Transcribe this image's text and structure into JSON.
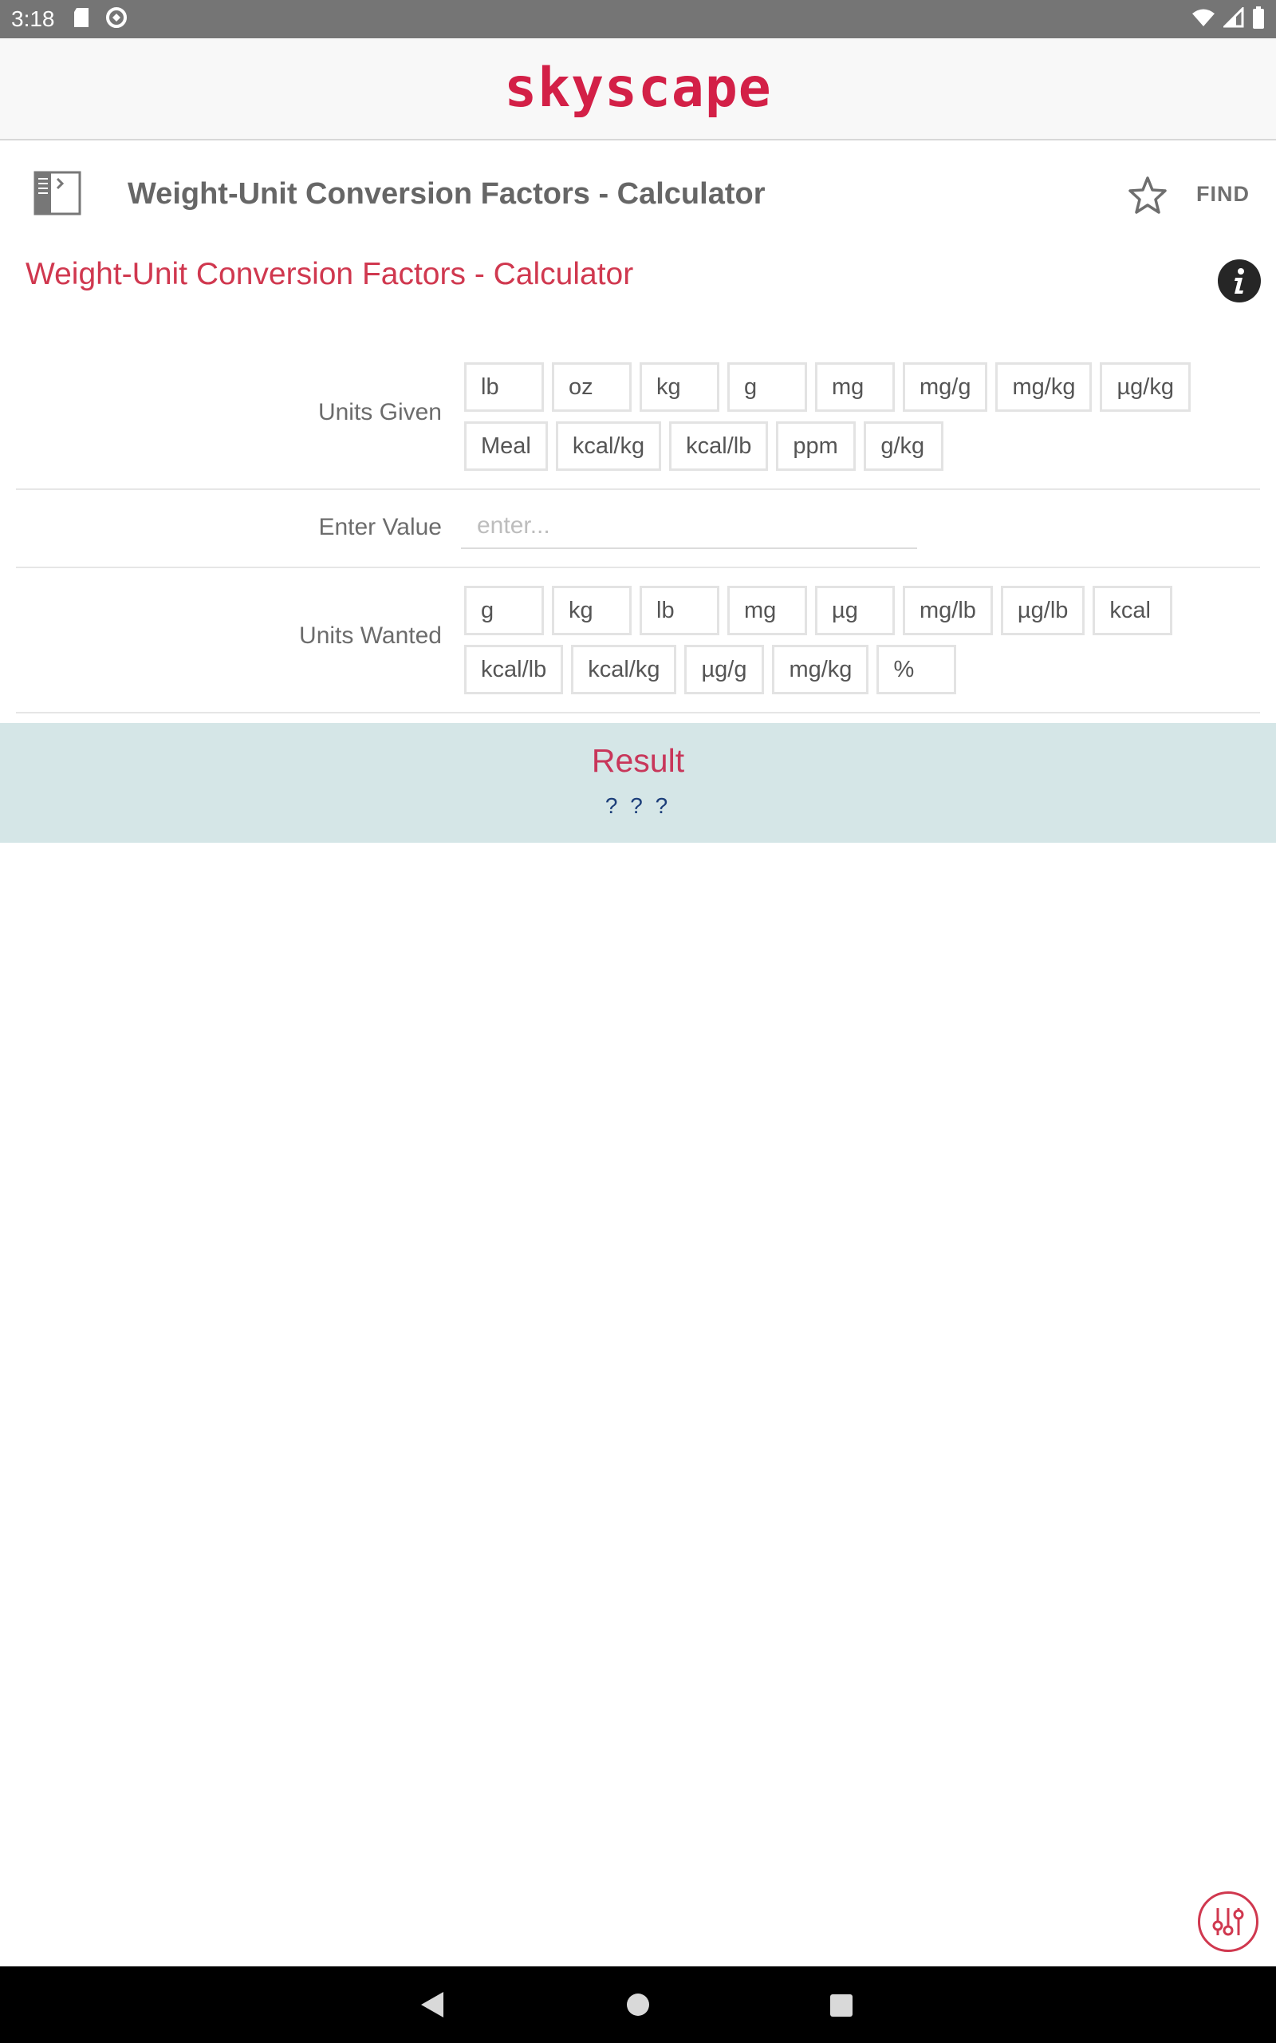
{
  "status_bar": {
    "time": "3:18",
    "left_icons": [
      "sd-card-icon",
      "data-saver-icon"
    ],
    "right_icons": [
      "wifi-icon",
      "cell-signal-icon",
      "battery-icon"
    ]
  },
  "brand": {
    "logo_text": "skyscape",
    "color": "#d32047"
  },
  "toolbar": {
    "title": "Weight-Unit Conversion Factors - Calculator",
    "find_label": "FIND"
  },
  "content": {
    "title": "Weight-Unit Conversion Factors - Calculator"
  },
  "form": {
    "units_given": {
      "label": "Units Given",
      "options": [
        "lb",
        "oz",
        "kg",
        "g",
        "mg",
        "mg/g",
        "mg/kg",
        "µg/kg",
        "Meal",
        "kcal/kg",
        "kcal/lb",
        "ppm",
        "g/kg"
      ]
    },
    "enter_value": {
      "label": "Enter Value",
      "value": "",
      "placeholder": "enter..."
    },
    "units_wanted": {
      "label": "Units Wanted",
      "options": [
        "g",
        "kg",
        "lb",
        "mg",
        "µg",
        "mg/lb",
        "µg/lb",
        "kcal",
        "kcal/lb",
        "kcal/kg",
        "µg/g",
        "mg/kg",
        "%"
      ]
    }
  },
  "result": {
    "title": "Result",
    "value": "? ? ?",
    "background": "#d5e6e7"
  },
  "accent_color": "#d0384f"
}
